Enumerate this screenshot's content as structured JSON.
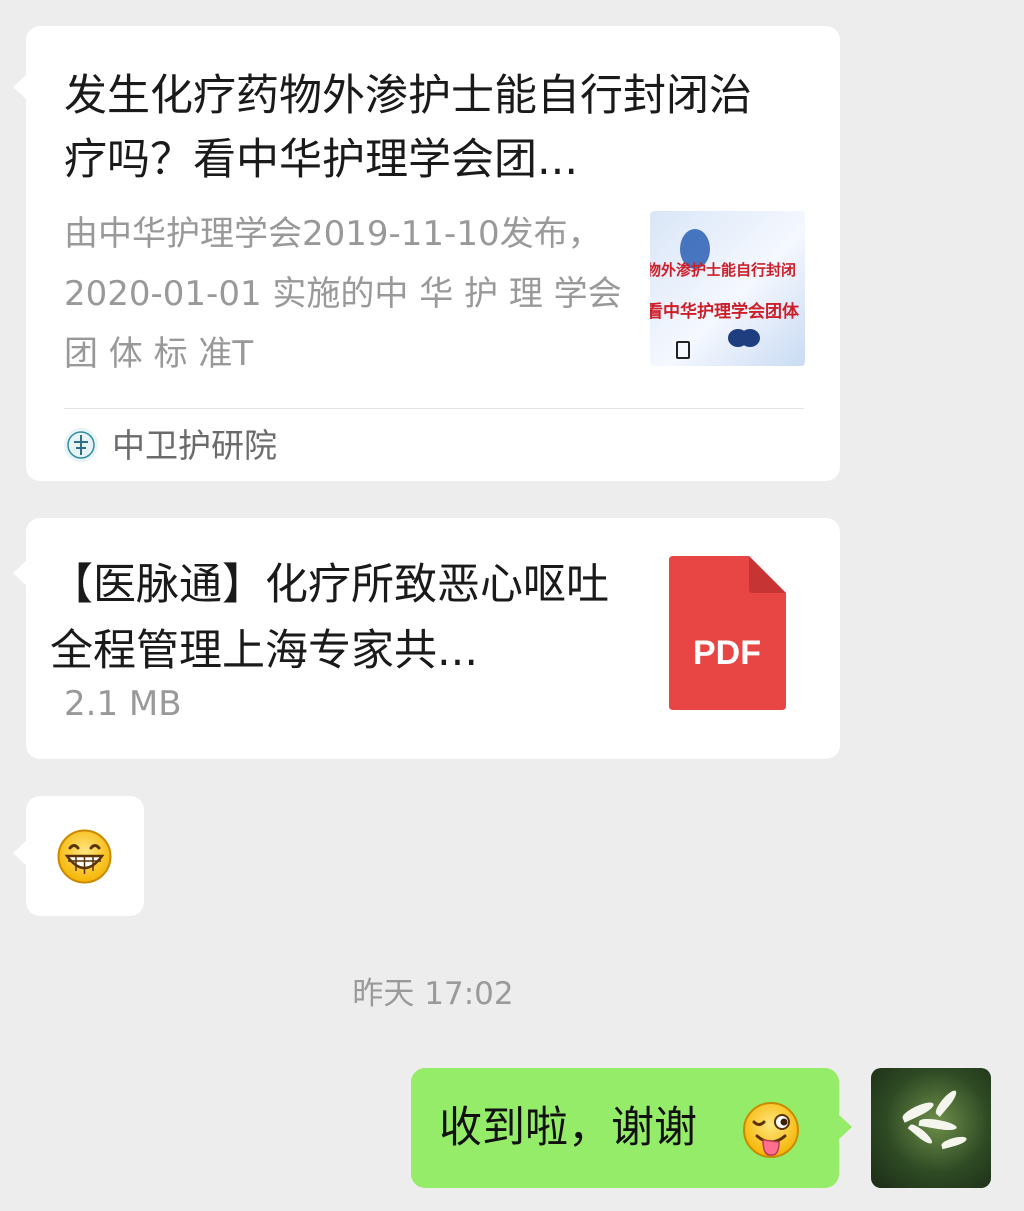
{
  "article_card": {
    "title": "发生化疗药物外渗护士能自行封闭治疗吗？看中华护理学会团...",
    "description": "由中华护理学会2019-11-10发布， 2020-01-01 实施的中 华 护 理 学会 团 体 标 准T",
    "thumbnail_text_1": "物外渗护士能自行封闭",
    "thumbnail_text_2": "看中华护理学会团体",
    "source_name": "中卫护研院",
    "source_icon": "organization-logo-icon"
  },
  "file_card": {
    "file_name": "【医脉通】化疗所致恶心呕吐全程管理上海专家共...",
    "file_size": "2.1 MB",
    "file_type_label": "PDF",
    "file_icon_color": "#e84545"
  },
  "emoji_message": {
    "emoji": "grinning-face-icon"
  },
  "timestamp": "昨天 17:02",
  "outgoing_message": {
    "text": "收到啦，谢谢",
    "emoji": "winking-tongue-face-icon"
  },
  "colors": {
    "background": "#ededed",
    "incoming_bubble": "#ffffff",
    "outgoing_bubble": "#95ec69",
    "secondary_text": "#999999"
  }
}
